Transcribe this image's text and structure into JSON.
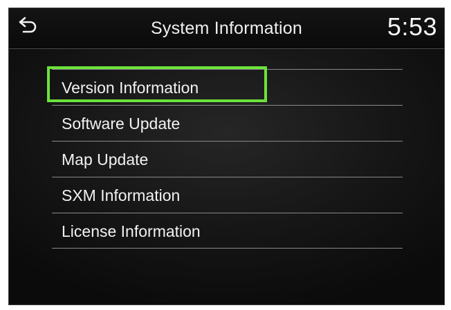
{
  "header": {
    "back_icon": "back-arrow-icon",
    "title": "System Information",
    "time": "5:53"
  },
  "menu": {
    "items": [
      {
        "label": "Version Information",
        "selected": true
      },
      {
        "label": "Software Update",
        "selected": false
      },
      {
        "label": "Map Update",
        "selected": false
      },
      {
        "label": "SXM Information",
        "selected": false
      },
      {
        "label": "License Information",
        "selected": false
      }
    ]
  },
  "colors": {
    "highlight": "#6de23a",
    "text": "#f2f2f2",
    "background": "#161616"
  }
}
